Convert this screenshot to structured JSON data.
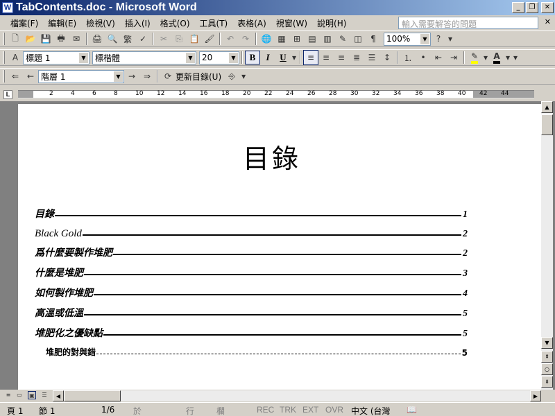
{
  "window": {
    "title": "TabContents.doc - Microsoft Word",
    "app_icon": "word-document-icon"
  },
  "menubar": {
    "items": [
      "檔案(F)",
      "編輯(E)",
      "檢視(V)",
      "插入(I)",
      "格式(O)",
      "工具(T)",
      "表格(A)",
      "視窗(W)",
      "說明(H)"
    ],
    "help_placeholder": "輸入需要解答的問題"
  },
  "formatting": {
    "style": "標題 1",
    "font": "標楷體",
    "size": "20",
    "bold_label": "B",
    "italic_label": "I",
    "underline_label": "U",
    "highlight_color": "#ffff00",
    "font_color": "#000000"
  },
  "standard": {
    "zoom": "100%"
  },
  "outline": {
    "level": "階層 1",
    "update_toc_label": "更新目錄(U)"
  },
  "document": {
    "title": "目錄",
    "toc": [
      {
        "text": "目錄",
        "page": "1",
        "level": 1
      },
      {
        "text": "Black Gold",
        "page": "2",
        "level": 1
      },
      {
        "text": "爲什麼要製作堆肥",
        "page": "2",
        "level": 1
      },
      {
        "text": "什麼是堆肥",
        "page": "3",
        "level": 1
      },
      {
        "text": "如何製作堆肥",
        "page": "4",
        "level": 1
      },
      {
        "text": "高溫或低溫",
        "page": "5",
        "level": 1
      },
      {
        "text": "堆肥化之優缺點",
        "page": "5",
        "level": 1
      },
      {
        "text": "堆肥的對與錯",
        "page": "5",
        "level": 2
      }
    ]
  },
  "ruler": {
    "numbers": [
      "2",
      "4",
      "6",
      "8",
      "10",
      "12",
      "14",
      "16",
      "18",
      "20",
      "22",
      "24",
      "26",
      "28",
      "30",
      "32",
      "34",
      "36",
      "38",
      "40",
      "42",
      "44"
    ]
  },
  "statusbar": {
    "page": "頁 1",
    "section": "節 1",
    "page_of": "1/6",
    "at": "於",
    "line": "行",
    "column": "欄",
    "rec": "REC",
    "trk": "TRK",
    "ext": "EXT",
    "ovr": "OVR",
    "language": "中文 (台灣"
  }
}
